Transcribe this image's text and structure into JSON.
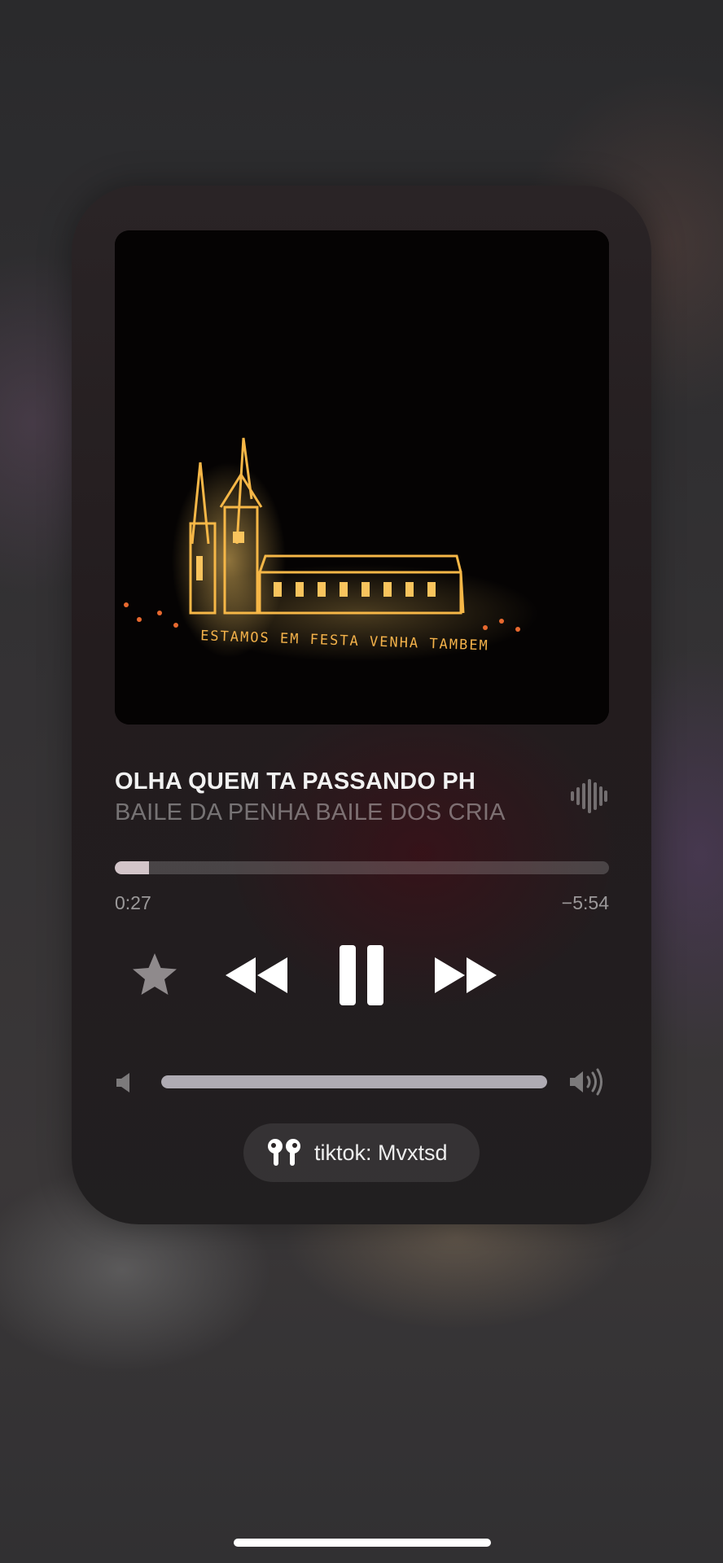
{
  "now_playing": {
    "title": "OLHA QUEM TA PASSANDO PH",
    "artist": "BAILE DA PENHA BAILE DOS CRIA",
    "artwork_text": "ESTAMOS EM FESTA VENHA TAMBEM"
  },
  "playback": {
    "elapsed": "0:27",
    "remaining": "−5:54",
    "progress_fraction": 0.07,
    "state": "playing"
  },
  "controls": {
    "favorite_icon": "star-icon",
    "previous_icon": "rewind-icon",
    "pause_icon": "pause-icon",
    "next_icon": "fast-forward-icon"
  },
  "volume": {
    "level_fraction": 1.0,
    "low_icon": "speaker-low-icon",
    "high_icon": "speaker-high-icon"
  },
  "output_device": {
    "icon": "airpods-icon",
    "label": "tiktok: Mvxtsd"
  },
  "colors": {
    "accent": "#f2f2f2",
    "secondary_text": "#8a8486",
    "art_lights": "#f5b94a"
  }
}
